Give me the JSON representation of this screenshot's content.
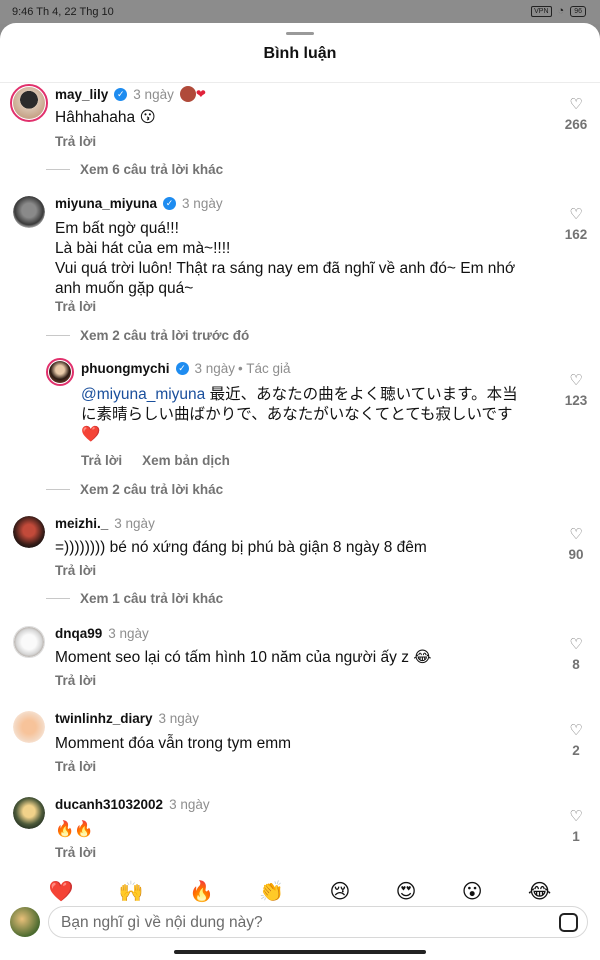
{
  "status_bar": {
    "time": "9:46",
    "date": "Th 4, 22 Thg 10",
    "vpn": "VPN",
    "battery": "96"
  },
  "sheet": {
    "title": "Bình luận"
  },
  "comments": [
    {
      "username": "may_lily",
      "verified": true,
      "time": "3 ngày",
      "text": "Hâhhahaha 😗",
      "reply_label": "Trả lời",
      "likes": "266",
      "view_more": "Xem 6 câu trả lời khác"
    },
    {
      "username": "miyuna_miyuna",
      "verified": true,
      "time": "3 ngày",
      "text_lines": [
        "Em bất ngờ quá!!!",
        "Là bài hát của em mà~!!!!",
        "Vui quá trời luôn! Thật ra sáng nay em đã nghĩ về anh đó~ Em nhớ",
        "anh muốn gặp quá~"
      ],
      "reply_label": "Trả lời",
      "likes": "162",
      "view_previous": "Xem 2 câu trả lời trước đó"
    },
    {
      "username": "phuongmychi",
      "verified": true,
      "time": "3 ngày",
      "author_tag": "• Tác giả",
      "mention": "@miyuna_miyuna",
      "text_line1": "最近、あなたの曲をよく聴いています。本当",
      "text_line2": "に素晴らしい曲ばかりで、あなたがいなくてとても寂しいです",
      "text_line3": "❤️",
      "reply_label": "Trả lời",
      "translate_label": "Xem bản dịch",
      "likes": "123",
      "view_more": "Xem 2 câu trả lời khác"
    },
    {
      "username": "meizhi._",
      "time": "3 ngày",
      "text": "=)))))))) bé nó xứng đáng bị phú bà giận 8 ngày 8 đêm",
      "reply_label": "Trả lời",
      "likes": "90",
      "view_more": "Xem 1 câu trả lời khác"
    },
    {
      "username": "dnqa99",
      "time": "3 ngày",
      "text": "Moment seo lại có tấm hình 10 năm của người ấy z 😂",
      "reply_label": "Trả lời",
      "likes": "8"
    },
    {
      "username": "twinlinhz_diary",
      "time": "3 ngày",
      "text": "Momment đóa vẫn trong tym emm",
      "reply_label": "Trả lời",
      "likes": "2"
    },
    {
      "username": "ducanh31032002",
      "time": "3 ngày",
      "text": "🔥🔥",
      "reply_label": "Trả lời",
      "likes": "1"
    }
  ],
  "quick_reactions": [
    "❤️",
    "🙌",
    "🔥",
    "👏",
    "😢",
    "😍",
    "😮",
    "😂"
  ],
  "composer": {
    "placeholder": "Bạn nghĩ gì về nội dung này?"
  },
  "icons": {
    "like": "heart-outline-icon",
    "verified": "verified-badge-icon",
    "sticker": "sticker-icon"
  },
  "colors": {
    "verified": "#1e8cf0",
    "mention": "#1a4f9c",
    "story_ring": "#e1306c"
  }
}
